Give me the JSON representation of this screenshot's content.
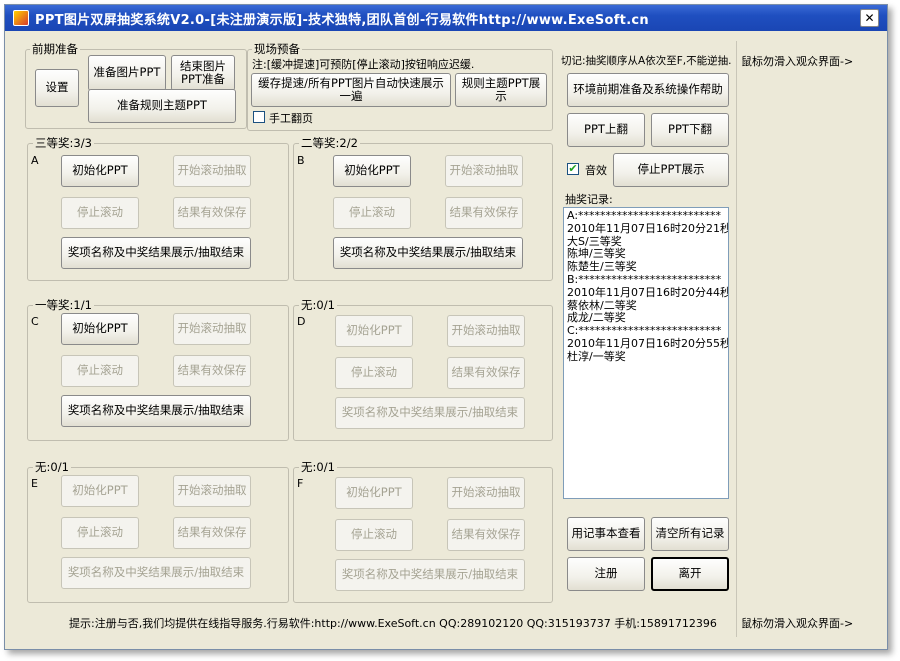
{
  "window": {
    "title": "PPT图片双屏抽奖系统V2.0-[未注册演示版]-技术独特,团队首创-行易软件http://www.ExeSoft.cn",
    "close_label": "✕"
  },
  "prep": {
    "legend": "前期准备",
    "settings": "设置",
    "prepare_images": "准备图片PPT",
    "end_images": "结束图片PPT准备",
    "prepare_rules": "准备规则主题PPT"
  },
  "live": {
    "legend": "现场预备",
    "note": "注:[缓冲提速]可预防[停止滚动]按钮响应迟缓.",
    "cache_button": "缓存提速/所有PPT图片自动快速展示一遍",
    "rules_show": "规则主题PPT展示",
    "manual_page_label": "手工翻页"
  },
  "groups": [
    {
      "label": "三等奖:3/3",
      "letter": "A"
    },
    {
      "label": "二等奖:2/2",
      "letter": "B"
    },
    {
      "label": "一等奖:1/1",
      "letter": "C"
    },
    {
      "label": "无:0/1",
      "letter": "D"
    },
    {
      "label": "无:0/1",
      "letter": "E"
    },
    {
      "label": "无:0/1",
      "letter": "F"
    }
  ],
  "group_buttons": {
    "init": "初始化PPT",
    "start": "开始滚动抽取",
    "stop": "停止滚动",
    "save": "结果有效保存",
    "show": "奖项名称及中奖结果展示/抽取结束"
  },
  "right_panel": {
    "warning": "切记:抽奖顺序从A依次至F,不能逆抽.",
    "help": "环境前期准备及系统操作帮助",
    "ppt_up": "PPT上翻",
    "ppt_down": "PPT下翻",
    "sound_label": "音效",
    "stop_ppt": "停止PPT展示",
    "records_label": "抽奖记录:",
    "records": [
      "A:**************************",
      "2010年11月07日16时20分21秒:",
      "大S/三等奖",
      "陈坤/三等奖",
      "陈楚生/三等奖",
      "B:**************************",
      "2010年11月07日16时20分44秒:",
      "蔡依林/二等奖",
      "成龙/二等奖",
      "C:**************************",
      "2010年11月07日16时20分55秒:",
      "杜淳/一等奖"
    ],
    "notepad": "用记事本查看",
    "clear": "清空所有记录",
    "register": "注册",
    "leave": "离开"
  },
  "side": {
    "top_hint": "鼠标勿滑入观众界面->",
    "bottom_hint": "鼠标勿滑入观众界面->"
  },
  "footer": "提示:注册与否,我们均提供在线指导服务.行易软件:http://www.ExeSoft.cn QQ:289102120 QQ:315193737 手机:15891712396"
}
